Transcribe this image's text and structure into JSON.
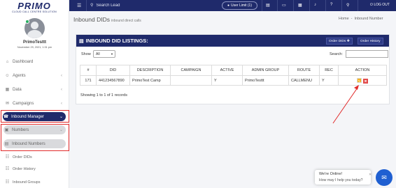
{
  "brand": {
    "logo_text": "PRIMO",
    "logo_sub": "CLOUD CALL CENTRE SOLUTION"
  },
  "user": {
    "name": "PrimoTesttt",
    "date": "November 29, 2021, 1:31 pm"
  },
  "sidebar": {
    "items": [
      {
        "label": "Dashboard",
        "icon": "dashboard-icon"
      },
      {
        "label": "Agents",
        "icon": "agents-icon"
      },
      {
        "label": "Data",
        "icon": "data-icon"
      },
      {
        "label": "Campaigns",
        "icon": "campaigns-icon"
      },
      {
        "label": "Inbound Manager",
        "icon": "phone-icon"
      },
      {
        "label": "Numbers",
        "icon": "numbers-icon"
      },
      {
        "label": "Inbound Numbers",
        "icon": "list-icon"
      },
      {
        "label": "Order DIDs",
        "icon": "users-icon"
      },
      {
        "label": "Order History",
        "icon": "users-icon"
      },
      {
        "label": "Inbound Groups",
        "icon": "users-icon"
      }
    ]
  },
  "topbar": {
    "search_placeholder": "Search Lead",
    "user_limit": "User Limit (1)",
    "logout": "LOG OUT"
  },
  "page": {
    "title": "Inbound DIDs",
    "subtitle": "inbound direct calls"
  },
  "breadcrumb": {
    "home": "Home",
    "separator": "-",
    "current": "Inbound Number"
  },
  "panel": {
    "title": "INBOUND DID LISTINGS:",
    "order_dids": "Order DIDs",
    "order_history": "Order History",
    "show_label": "Show",
    "show_value": "All",
    "search_label": "Search:",
    "showing_text": "Showing 1 to 1 of 1 records"
  },
  "table": {
    "headers": [
      "#",
      "DID",
      "DESCRIPTION",
      "CAMPAIGN",
      "ACTIVE",
      "ADMIN GROUP",
      "ROUTE",
      "REC",
      "ACTION"
    ],
    "rows": [
      [
        "171",
        "441234567890",
        "PrimoTest Camp",
        "",
        "Y",
        "PrimoTesttt",
        "CALLMENU",
        "Y"
      ]
    ]
  },
  "chat": {
    "line1": "We're Online!",
    "line2": "How may I help you today?"
  },
  "colors": {
    "primary": "#1f2a6b",
    "highlight": "#e12a2a",
    "edit": "#f5b21b",
    "delete": "#e14b4b"
  }
}
